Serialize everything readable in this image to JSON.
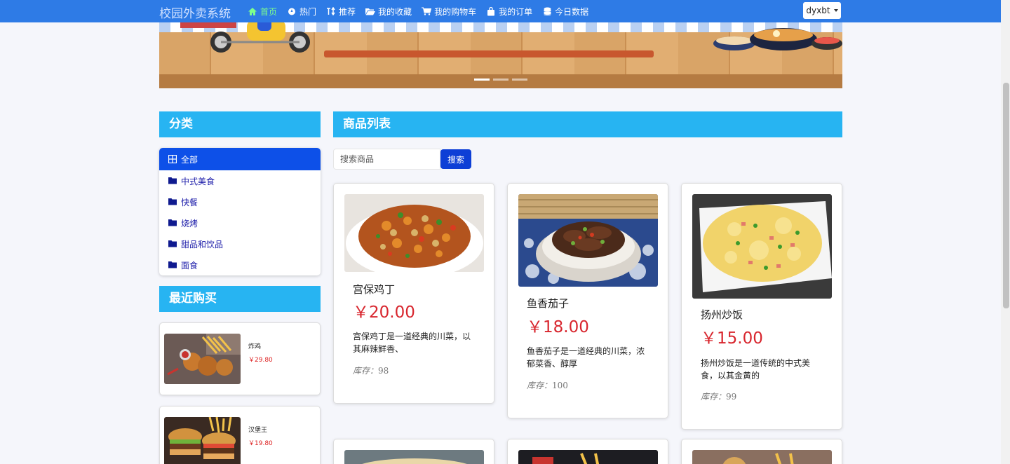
{
  "header": {
    "brand": "校园外卖系统",
    "nav": [
      {
        "label": "首页",
        "icon": "home-icon",
        "active": true
      },
      {
        "label": "热门",
        "icon": "fire-icon",
        "active": false
      },
      {
        "label": "推荐",
        "icon": "sort-icon",
        "active": false
      },
      {
        "label": "我的收藏",
        "icon": "folder-open-icon",
        "active": false
      },
      {
        "label": "我的购物车",
        "icon": "cart-icon",
        "active": false
      },
      {
        "label": "我的订单",
        "icon": "bag-icon",
        "active": false
      },
      {
        "label": "今日数据",
        "icon": "database-icon",
        "active": false
      }
    ],
    "user": "dyxbt",
    "accent": "#2e7be6",
    "active_color": "#7dff8c"
  },
  "banner": {
    "slides": 3,
    "active_slide": 1
  },
  "sidebar": {
    "category_title": "分类",
    "categories": [
      {
        "label": "全部",
        "icon": "grid-icon",
        "active": true
      },
      {
        "label": "中式美食",
        "icon": "folder-icon",
        "active": false
      },
      {
        "label": "快餐",
        "icon": "folder-icon",
        "active": false
      },
      {
        "label": "烧烤",
        "icon": "folder-icon",
        "active": false
      },
      {
        "label": "甜品和饮品",
        "icon": "folder-icon",
        "active": false
      },
      {
        "label": "面食",
        "icon": "folder-icon",
        "active": false
      }
    ],
    "recent_title": "最近购买",
    "recent": [
      {
        "name": "炸鸡",
        "price": "￥29.80"
      },
      {
        "name": "汉堡王",
        "price": "￥19.80"
      }
    ]
  },
  "main": {
    "title": "商品列表",
    "search": {
      "placeholder": "搜索商品",
      "button": "搜索"
    },
    "stock_label": "库存：",
    "products": [
      {
        "name": "宫保鸡丁",
        "price": "￥20.00",
        "desc": "宫保鸡丁是一道经典的川菜，以其麻辣鲜香、",
        "stock": "98"
      },
      {
        "name": "鱼香茄子",
        "price": "￥18.00",
        "desc": "鱼香茄子是一道经典的川菜，浓郁菜香、醇厚",
        "stock": "100"
      },
      {
        "name": "扬州炒饭",
        "price": "￥15.00",
        "desc": "扬州炒饭是一道传统的中式美食，以其金黄的",
        "stock": "99"
      }
    ]
  },
  "colors": {
    "section_header": "#27b4f2",
    "primary_button": "#0d3fd6",
    "price": "#d8262e"
  }
}
